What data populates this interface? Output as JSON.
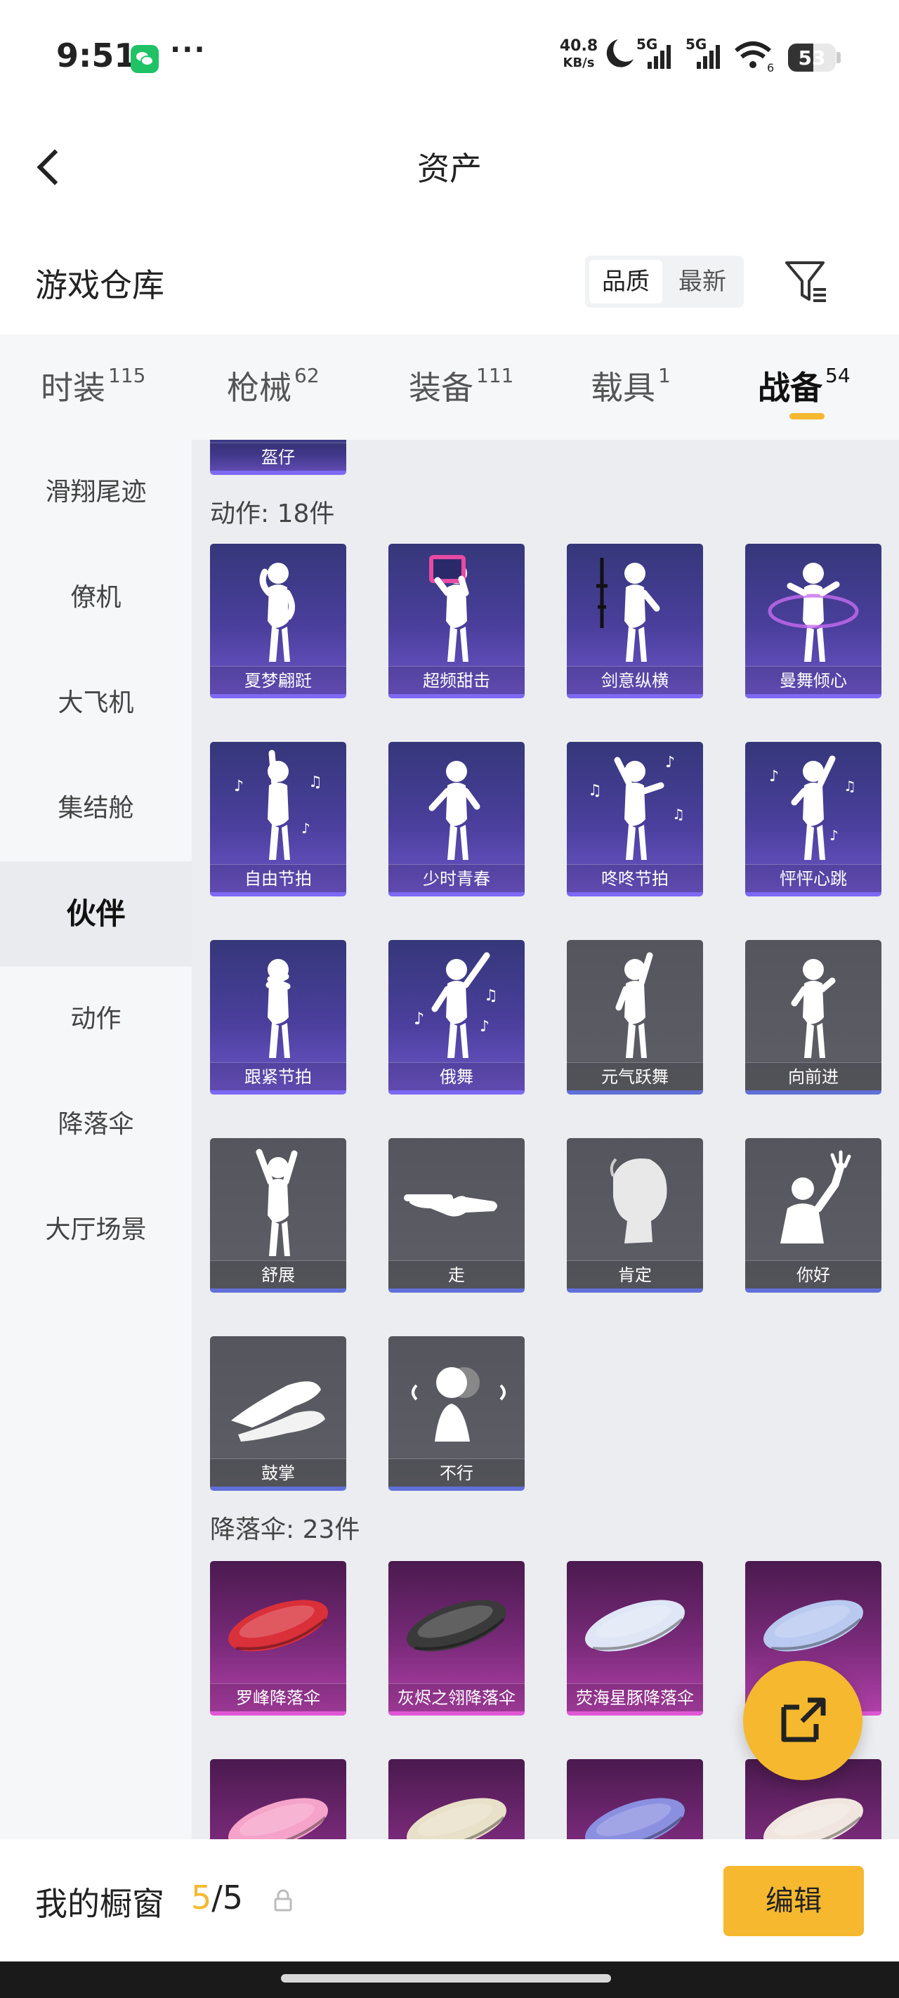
{
  "status_bar": {
    "time": "9:51",
    "more": "···",
    "speed_value": "40.8",
    "speed_unit": "KB/s",
    "signal_1": "5G",
    "signal_2": "5G",
    "wifi_sub": "6",
    "battery": "53"
  },
  "header": {
    "title": "资产"
  },
  "warehouse": {
    "title": "游戏仓库",
    "sort_quality": "品质",
    "sort_newest": "最新"
  },
  "tabs": [
    {
      "label": "时装",
      "count": "115"
    },
    {
      "label": "枪械",
      "count": "62"
    },
    {
      "label": "装备",
      "count": "111"
    },
    {
      "label": "载具",
      "count": "1"
    },
    {
      "label": "战备",
      "count": "54"
    }
  ],
  "sidebar": [
    "滑翔尾迹",
    "僚机",
    "大飞机",
    "集结舱",
    "伙伴",
    "动作",
    "降落伞",
    "大厅场景"
  ],
  "partial_card": "盔仔",
  "actions": {
    "title": "动作: 18件",
    "items": [
      {
        "label": "夏梦翩跹",
        "style": "purple",
        "pose": "pose-a"
      },
      {
        "label": "超频甜击",
        "style": "purple",
        "pose": "pose-b"
      },
      {
        "label": "剑意纵横",
        "style": "purple",
        "pose": "pose-c"
      },
      {
        "label": "曼舞倾心",
        "style": "purple",
        "pose": "pose-d"
      },
      {
        "label": "自由节拍",
        "style": "purple",
        "pose": "pose-e"
      },
      {
        "label": "少时青春",
        "style": "purple",
        "pose": "pose-f"
      },
      {
        "label": "咚咚节拍",
        "style": "purple",
        "pose": "pose-g"
      },
      {
        "label": "怦怦心跳",
        "style": "purple",
        "pose": "pose-h"
      },
      {
        "label": "跟紧节拍",
        "style": "purple",
        "pose": "pose-i"
      },
      {
        "label": "俄舞",
        "style": "purple",
        "pose": "pose-j"
      },
      {
        "label": "元气跃舞",
        "style": "grey",
        "pose": "pose-k"
      },
      {
        "label": "向前进",
        "style": "grey",
        "pose": "pose-l"
      },
      {
        "label": "舒展",
        "style": "grey",
        "pose": "pose-m"
      },
      {
        "label": "走",
        "style": "grey",
        "pose": "hand-point"
      },
      {
        "label": "肯定",
        "style": "grey",
        "pose": "head-nod"
      },
      {
        "label": "你好",
        "style": "grey",
        "pose": "wave"
      },
      {
        "label": "鼓掌",
        "style": "grey",
        "pose": "clap"
      },
      {
        "label": "不行",
        "style": "grey",
        "pose": "head-shake"
      }
    ]
  },
  "parachutes": {
    "title": "降落伞: 23件",
    "items": [
      {
        "label": "罗峰降落伞",
        "style": "pink",
        "color": "#d9303a"
      },
      {
        "label": "灰烬之翎降落伞",
        "style": "pink",
        "color": "#3a3a3a"
      },
      {
        "label": "荧海星豚降落伞",
        "style": "pink",
        "color": "#dfe6f5"
      },
      {
        "label": "",
        "style": "pink",
        "color": "#b9c9ef"
      },
      {
        "label": "",
        "style": "pink",
        "color": "#f5a3c8"
      },
      {
        "label": "",
        "style": "pink",
        "color": "#e8e0c8"
      },
      {
        "label": "",
        "style": "pink",
        "color": "#8a8fe0"
      },
      {
        "label": "",
        "style": "pink",
        "color": "#f1e6df"
      }
    ]
  },
  "showcase": {
    "label": "我的橱窗",
    "current": "5",
    "total": "/5",
    "edit": "编辑"
  },
  "colors": {
    "accent": "#f5b82e",
    "purple_card": "#4a3f9c",
    "grey_card": "#5e5e66",
    "pink_card": "#7a2a7a"
  }
}
